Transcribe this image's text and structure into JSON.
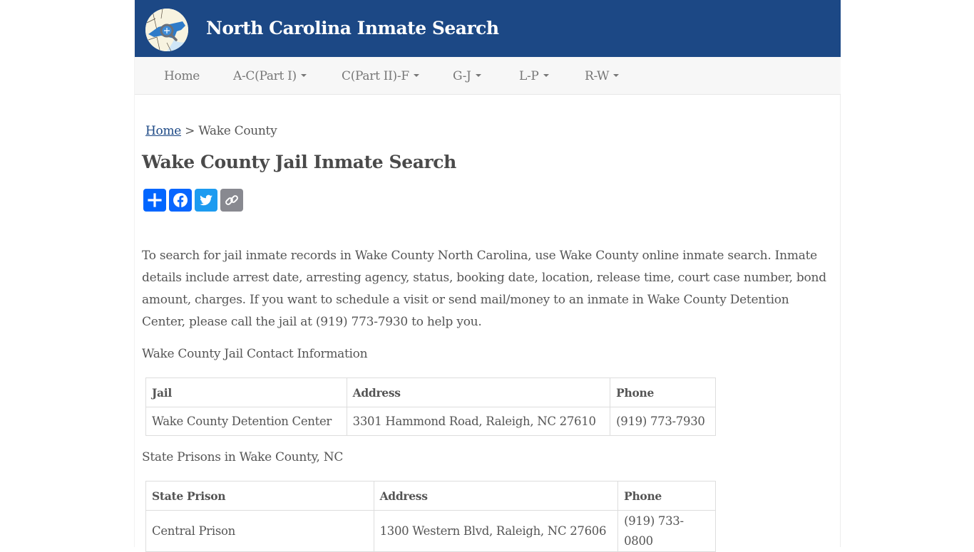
{
  "header": {
    "logo_icon": "nc-map-magnifier-icon",
    "site_title": "North Carolina Inmate Search",
    "brand_color": "#1c4885"
  },
  "nav": {
    "items": [
      {
        "label": "Home",
        "dropdown": false
      },
      {
        "label": "A-C(Part I)",
        "dropdown": true
      },
      {
        "label": "C(Part II)-F",
        "dropdown": true
      },
      {
        "label": "G-J",
        "dropdown": true
      },
      {
        "label": "L-P",
        "dropdown": true
      },
      {
        "label": "R-W",
        "dropdown": true
      }
    ]
  },
  "breadcrumb": {
    "home_label": "Home",
    "separator": ">",
    "current": "Wake County"
  },
  "page_title": "Wake County Jail Inmate Search",
  "share": {
    "buttons": [
      {
        "name": "share-plus",
        "icon": "plus-icon",
        "color": "#0166ff"
      },
      {
        "name": "facebook",
        "icon": "facebook-icon",
        "color": "#0866ff"
      },
      {
        "name": "twitter",
        "icon": "twitter-icon",
        "color": "#1d9bf0"
      },
      {
        "name": "copy-link",
        "icon": "link-icon",
        "color": "#888990"
      }
    ]
  },
  "intro_text": "To search for jail inmate records in Wake County North Carolina, use Wake County online inmate search. Inmate details include arrest date, arresting agency, status, booking date, location, release time, court case number, bond amount, charges. If you want to schedule a visit or send mail/money to an inmate in Wake County Detention Center, please call the jail at (919) 773-7930 to help you.",
  "jail_section": {
    "label": "Wake County Jail Contact Information",
    "headers": [
      "Jail",
      "Address",
      "Phone"
    ],
    "rows": [
      [
        "Wake County Detention Center",
        "3301 Hammond Road, Raleigh, NC 27610",
        "(919) 773-7930"
      ]
    ]
  },
  "prison_section": {
    "label": "State Prisons in Wake County, NC",
    "headers": [
      "State Prison",
      "Address",
      "Phone"
    ],
    "rows": [
      [
        "Central Prison",
        "1300 Western Blvd, Raleigh, NC 27606",
        "(919) 733-0800"
      ]
    ]
  }
}
